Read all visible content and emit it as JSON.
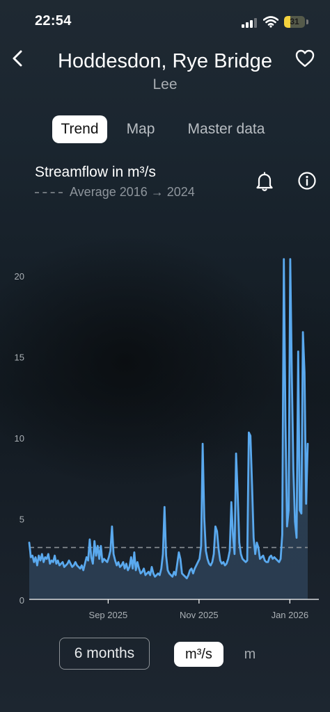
{
  "status_bar": {
    "time": "22:54",
    "battery": "31",
    "battery_level": 0.31
  },
  "header": {
    "title": "Hoddesdon, Rye Bridge",
    "subtitle": "Lee"
  },
  "tabs": [
    {
      "label": "Trend",
      "active": true
    },
    {
      "label": "Map",
      "active": false
    },
    {
      "label": "Master data",
      "active": false
    }
  ],
  "metric": {
    "title": "Streamflow in m³/s",
    "average_label": "Average 2016 → 2024"
  },
  "icons": {
    "back": "chevron-left-icon",
    "favorite": "heart-icon",
    "alert": "bell-icon",
    "info": "info-icon"
  },
  "colors": {
    "accent": "#5aa9ee",
    "area_fill": "#2d4156",
    "average_line": "#8a9096",
    "active_tab_bg": "#ffffff"
  },
  "controls": {
    "range": "6 months",
    "units": [
      {
        "label": "m³/s",
        "active": true
      },
      {
        "label": "m",
        "active": false
      }
    ]
  },
  "chart_data": {
    "type": "area",
    "ylabel": "",
    "xlabel": "",
    "ylim": [
      0,
      21
    ],
    "yticks": [
      "0",
      "5",
      "10",
      "15",
      "20"
    ],
    "xticks": [
      {
        "label": "Sep 2025",
        "date": "2025-09-01"
      },
      {
        "label": "Nov 2025",
        "date": "2025-11-01"
      },
      {
        "label": "Jan 2026",
        "date": "2026-01-01"
      }
    ],
    "x_start": "2025-07-10",
    "x_end": "2026-01-13",
    "average": 3.2,
    "grid": false,
    "series": [
      {
        "values": [
          3.5,
          2.6,
          2.7,
          2.3,
          2.6,
          2.1,
          2.7,
          2.4,
          2.8,
          2.3,
          2.6,
          2.5,
          2.8,
          2.2,
          2.4,
          2.3,
          2.7,
          2.2,
          2.4,
          2.1,
          2.2,
          2.3,
          2.0,
          2.1,
          2.2,
          2.4,
          2.2,
          2.0,
          2.1,
          2.3,
          2.1,
          2.0,
          1.9,
          2.1,
          1.8,
          2.2,
          2.6,
          2.4,
          3.7,
          2.6,
          2.2,
          3.6,
          2.7,
          3.3,
          2.5,
          3.3,
          2.3,
          2.5,
          2.4,
          2.3,
          2.6,
          3.0,
          4.5,
          2.8,
          2.4,
          2.1,
          2.3,
          2.0,
          2.1,
          2.3,
          1.9,
          2.2,
          1.8,
          2.0,
          2.6,
          1.9,
          2.9,
          1.8,
          2.3,
          1.9,
          1.6,
          1.7,
          1.9,
          1.5,
          1.6,
          1.7,
          1.5,
          2.0,
          1.6,
          1.4,
          1.5,
          1.6,
          1.5,
          1.9,
          2.8,
          5.7,
          2.7,
          1.8,
          1.6,
          1.5,
          1.4,
          1.7,
          1.5,
          2.2,
          2.9,
          2.5,
          1.6,
          1.5,
          1.4,
          1.3,
          1.5,
          1.8,
          1.9,
          1.6,
          1.9,
          2.1,
          2.3,
          2.5,
          3.3,
          9.6,
          5.0,
          3.0,
          2.5,
          2.2,
          2.1,
          2.3,
          2.8,
          4.5,
          4.2,
          3.1,
          2.4,
          2.2,
          2.3,
          2.1,
          2.2,
          2.5,
          3.0,
          6.0,
          4.0,
          2.8,
          9.0,
          6.5,
          3.5,
          2.8,
          2.5,
          2.4,
          2.3,
          2.4,
          10.3,
          10.1,
          7.1,
          3.8,
          2.8,
          3.5,
          3.2,
          2.5,
          2.6,
          2.7,
          2.4,
          2.3,
          2.3,
          2.6,
          2.7,
          2.5,
          2.6,
          2.5,
          2.4,
          2.3,
          2.5,
          4.0,
          21.0,
          11.0,
          4.5,
          5.5,
          21.0,
          14.0,
          8.0,
          4.8,
          3.8,
          15.3,
          5.5,
          5.3,
          16.5,
          14.0,
          5.9,
          9.6
        ]
      }
    ]
  }
}
